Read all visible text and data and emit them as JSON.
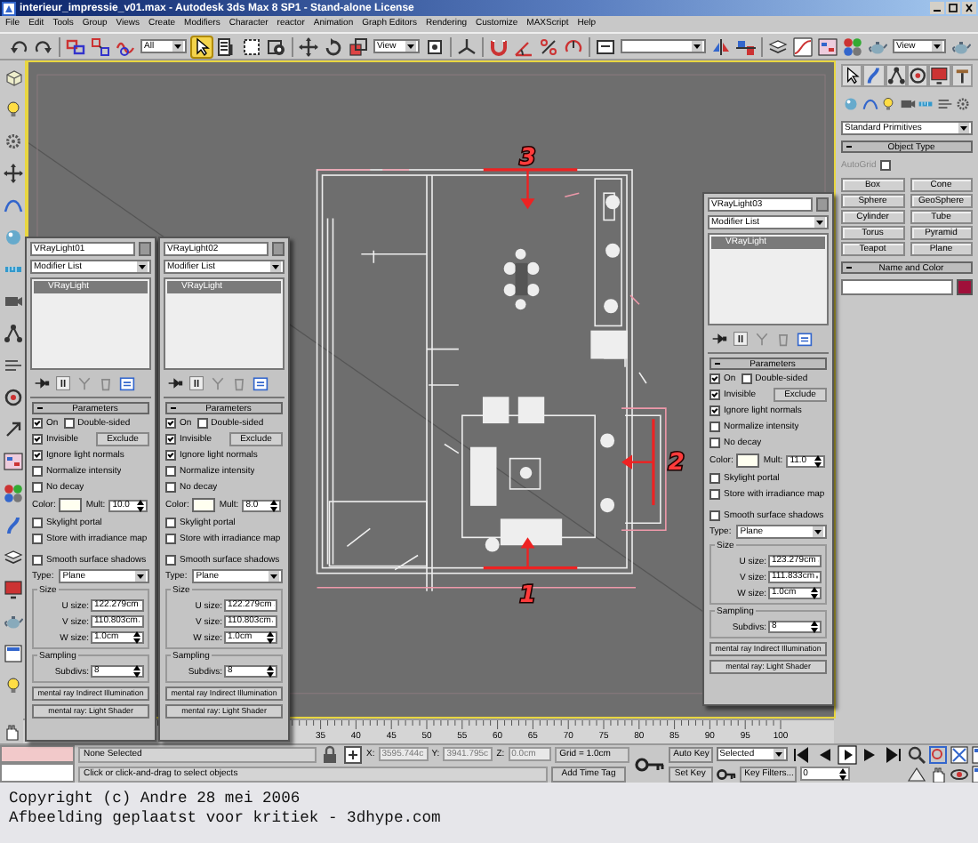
{
  "window": {
    "title": "interieur_impressie_v01.max - Autodesk 3ds Max 8 SP1 - Stand-alone License"
  },
  "menu": [
    "File",
    "Edit",
    "Tools",
    "Group",
    "Views",
    "Create",
    "Modifiers",
    "Character",
    "reactor",
    "Animation",
    "Graph Editors",
    "Rendering",
    "Customize",
    "MAXScript",
    "Help"
  ],
  "toolbar": {
    "selection_filter": "All",
    "select_tool_selected": true,
    "reference_coord": "View",
    "render_view": "View"
  },
  "viewport": {
    "annotations": [
      {
        "label": "3"
      },
      {
        "label": "2"
      },
      {
        "label": "1"
      }
    ]
  },
  "light_panels": [
    {
      "name": "VRayLight01",
      "modifier_list": "Modifier List",
      "stack": [
        {
          "label": "VRayLight",
          "selected": true
        }
      ],
      "rollout": "Parameters",
      "checks": [
        {
          "label": "On",
          "checked": true
        },
        {
          "label": "Double-sided",
          "checked": false
        },
        {
          "label": "Invisible",
          "checked": true
        },
        {
          "label": "Ignore light normals",
          "checked": true
        },
        {
          "label": "Normalize intensity",
          "checked": false
        },
        {
          "label": "No decay",
          "checked": false
        }
      ],
      "exclude": "Exclude",
      "color_label": "Color:",
      "color": "#fffff0",
      "mult_label": "Mult:",
      "mult": "10.0",
      "extra_checks": [
        {
          "label": "Skylight portal",
          "checked": false
        },
        {
          "label": "Store with irradiance map",
          "checked": false
        },
        {
          "label": "Smooth surface shadows",
          "checked": false
        }
      ],
      "type_label": "Type:",
      "type": "Plane",
      "size_title": "Size",
      "sizes": [
        {
          "label": "U size:",
          "value": "122.279cm"
        },
        {
          "label": "V size:",
          "value": "110.803cm"
        },
        {
          "label": "W size:",
          "value": "1.0cm"
        }
      ],
      "sampling_title": "Sampling",
      "subdivs_label": "Subdivs:",
      "subdivs": "8",
      "buttons": [
        "mental ray Indirect Illumination",
        "mental ray: Light Shader"
      ]
    },
    {
      "name": "VRayLight02",
      "modifier_list": "Modifier List",
      "stack": [
        {
          "label": "VRayLight",
          "selected": true
        }
      ],
      "rollout": "Parameters",
      "checks": [
        {
          "label": "On",
          "checked": true
        },
        {
          "label": "Double-sided",
          "checked": false
        },
        {
          "label": "Invisible",
          "checked": true
        },
        {
          "label": "Ignore light normals",
          "checked": true
        },
        {
          "label": "Normalize intensity",
          "checked": false
        },
        {
          "label": "No decay",
          "checked": false
        }
      ],
      "exclude": "Exclude",
      "color_label": "Color:",
      "color": "#fffff0",
      "mult_label": "Mult:",
      "mult": "8.0",
      "extra_checks": [
        {
          "label": "Skylight portal",
          "checked": false
        },
        {
          "label": "Store with irradiance map",
          "checked": false
        },
        {
          "label": "Smooth surface shadows",
          "checked": false
        }
      ],
      "type_label": "Type:",
      "type": "Plane",
      "size_title": "Size",
      "sizes": [
        {
          "label": "U size:",
          "value": "122.279cm"
        },
        {
          "label": "V size:",
          "value": "110.803cm"
        },
        {
          "label": "W size:",
          "value": "1.0cm"
        }
      ],
      "sampling_title": "Sampling",
      "subdivs_label": "Subdivs:",
      "subdivs": "8",
      "buttons": [
        "mental ray Indirect Illumination",
        "mental ray: Light Shader"
      ]
    },
    {
      "name": "VRayLight03",
      "modifier_list": "Modifier List",
      "stack": [
        {
          "label": "VRayLight",
          "selected": true
        }
      ],
      "rollout": "Parameters",
      "checks": [
        {
          "label": "On",
          "checked": true
        },
        {
          "label": "Double-sided",
          "checked": false
        },
        {
          "label": "Invisible",
          "checked": true
        },
        {
          "label": "Ignore light normals",
          "checked": true
        },
        {
          "label": "Normalize intensity",
          "checked": false
        },
        {
          "label": "No decay",
          "checked": false
        }
      ],
      "exclude": "Exclude",
      "color_label": "Color:",
      "color": "#fffff0",
      "mult_label": "Mult:",
      "mult": "11.0",
      "extra_checks": [
        {
          "label": "Skylight portal",
          "checked": false
        },
        {
          "label": "Store with irradiance map",
          "checked": false
        },
        {
          "label": "Smooth surface shadows",
          "checked": false
        }
      ],
      "type_label": "Type:",
      "type": "Plane",
      "size_title": "Size",
      "sizes": [
        {
          "label": "U size:",
          "value": "123.279cm"
        },
        {
          "label": "V size:",
          "value": "111.833cm"
        },
        {
          "label": "W size:",
          "value": "1.0cm"
        }
      ],
      "sampling_title": "Sampling",
      "subdivs_label": "Subdivs:",
      "subdivs": "8",
      "buttons": [
        "mental ray Indirect Illumination",
        "mental ray: Light Shader"
      ]
    }
  ],
  "command_panel": {
    "category": "Standard Primitives",
    "object_type": "Object Type",
    "autogrid": {
      "label": "AutoGrid",
      "checked": false
    },
    "buttons": [
      "Box",
      "Cone",
      "Sphere",
      "GeoSphere",
      "Cylinder",
      "Tube",
      "Torus",
      "Pyramid",
      "Teapot",
      "Plane"
    ],
    "name_color": "Name and Color",
    "color": "#a0103a"
  },
  "timeline": {
    "frames": [
      "35",
      "40",
      "45",
      "50",
      "55",
      "60",
      "65",
      "70",
      "75",
      "80",
      "85",
      "90",
      "95",
      "100"
    ]
  },
  "status_bar": {
    "selection": "None Selected",
    "x_label": "X:",
    "x": "3595.744c",
    "y_label": "Y:",
    "y": "3941.795c",
    "z_label": "Z:",
    "z": "0.0cm",
    "grid": "Grid = 1.0cm",
    "prompt": "Click or click-and-drag to select objects",
    "time_tag": "Add Time Tag",
    "auto_key": "Auto Key",
    "key_mode": "Selected",
    "set_key": "Set Key",
    "key_filters": "Key Filters...",
    "frame": "0"
  },
  "caption": [
    "Copyright (c) Andre 28 mei 2006",
    "Afbeelding geplaatst voor kritiek - 3dhype.com"
  ]
}
